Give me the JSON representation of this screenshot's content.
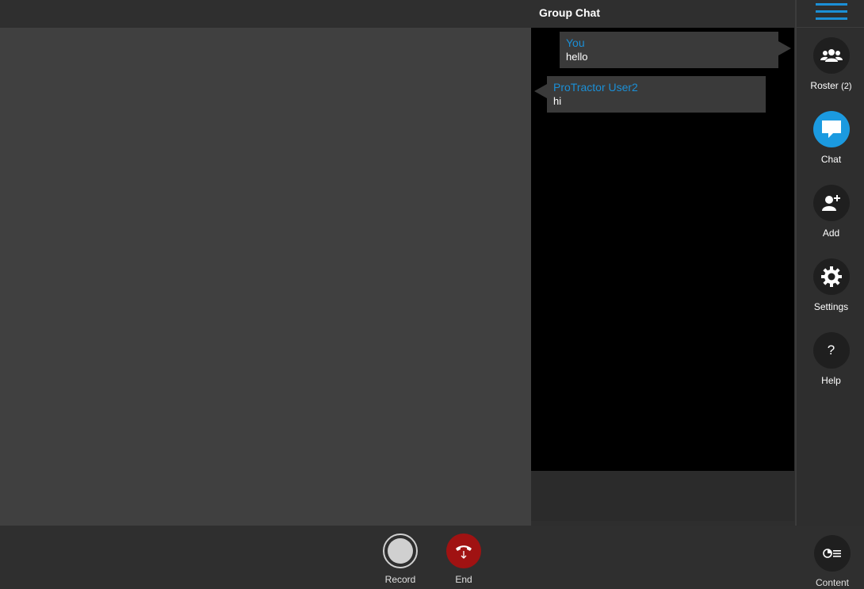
{
  "header": {
    "chat_title": "Group Chat"
  },
  "chat": {
    "messages": [
      {
        "sender": "You",
        "text": "hello"
      },
      {
        "sender": "ProTractor User2",
        "text": "hi"
      }
    ]
  },
  "sidebar": {
    "menu_icon": "hamburger-menu-icon",
    "items": [
      {
        "label": "Roster",
        "count": "(2)",
        "icon": "group-icon"
      },
      {
        "label": "Chat",
        "icon": "chat-bubble-icon",
        "active": true
      },
      {
        "label": "Add",
        "icon": "add-user-icon"
      },
      {
        "label": "Settings",
        "icon": "gear-icon"
      },
      {
        "label": "Help",
        "icon": "help-icon",
        "glyph": "?"
      }
    ]
  },
  "controls": {
    "record": {
      "label": "Record",
      "icon": "record-icon"
    },
    "end": {
      "label": "End",
      "icon": "hang-up-icon"
    },
    "content": {
      "label": "Content",
      "icon": "content-icon"
    }
  },
  "colors": {
    "accent": "#1b9ae0",
    "end_call": "#a01212",
    "sender_name": "#1b8fd6"
  }
}
